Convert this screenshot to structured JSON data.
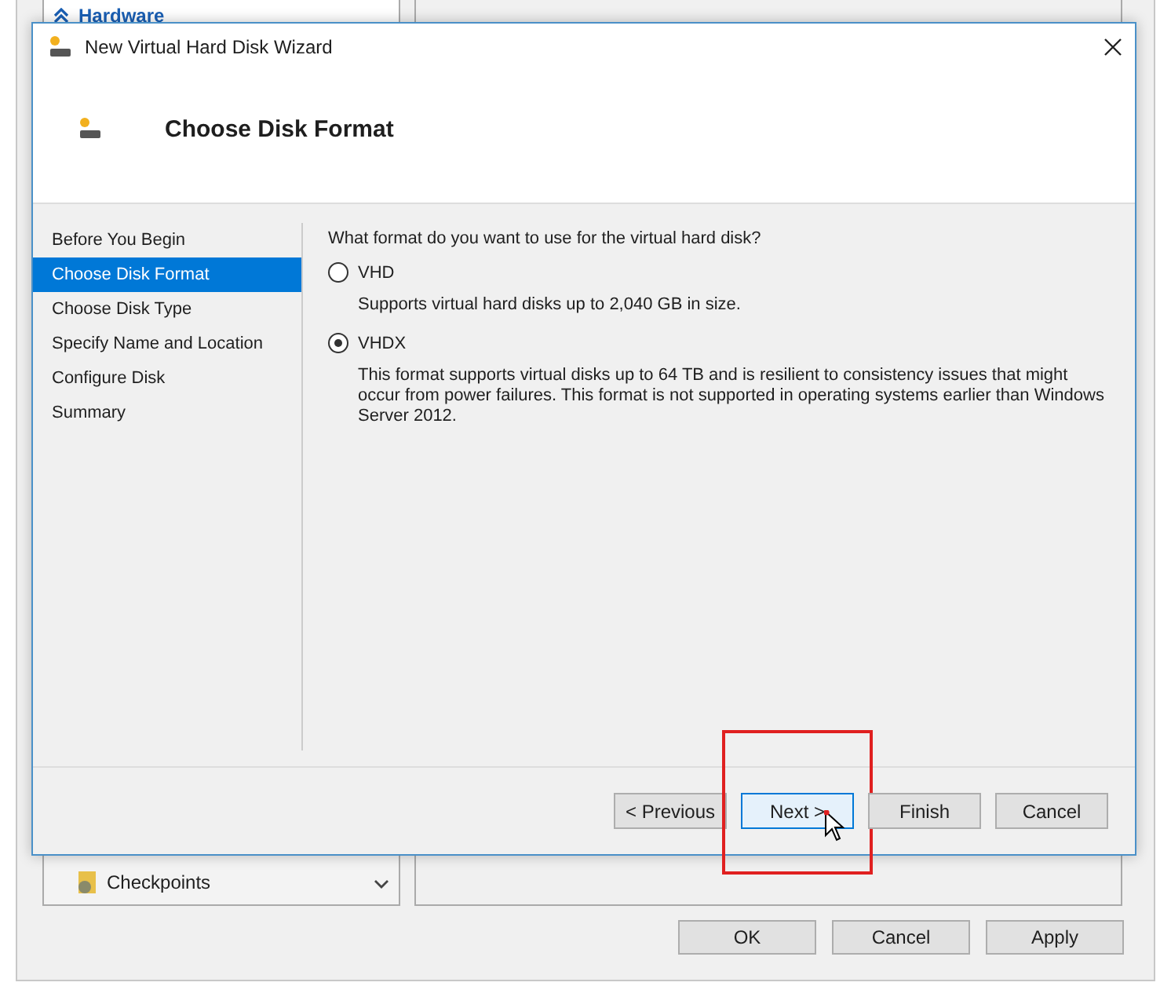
{
  "background_window": {
    "list_header": "Hardware",
    "list_items": [
      {
        "label": "Checkpoints",
        "kind": "item"
      }
    ],
    "buttons": [
      "OK",
      "Cancel",
      "Apply"
    ]
  },
  "window": {
    "title": "New Virtual Hard Disk Wizard"
  },
  "header": {
    "title": "Choose Disk Format"
  },
  "steps": [
    {
      "label": "Before You Begin",
      "selected": false
    },
    {
      "label": "Choose Disk Format",
      "selected": true
    },
    {
      "label": "Choose Disk Type",
      "selected": false
    },
    {
      "label": "Specify Name and Location",
      "selected": false
    },
    {
      "label": "Configure Disk",
      "selected": false
    },
    {
      "label": "Summary",
      "selected": false
    }
  ],
  "question": "What format do you want to use for the virtual hard disk?",
  "options": [
    {
      "label": "VHD",
      "description": "Supports virtual hard disks up to 2,040 GB in size.",
      "selected": false
    },
    {
      "label": "VHDX",
      "description": "This format supports virtual disks up to 64 TB and is resilient to consistency issues that might occur from power failures. This format is not supported in operating systems earlier than Windows Server 2012.",
      "selected": true
    }
  ],
  "buttons": [
    {
      "label": "< Previous",
      "default": false,
      "highlighted": false
    },
    {
      "label": "Next >",
      "default": true,
      "highlighted": true
    },
    {
      "label": "Finish",
      "default": false,
      "highlighted": false
    },
    {
      "label": "Cancel",
      "default": false,
      "highlighted": false
    }
  ]
}
